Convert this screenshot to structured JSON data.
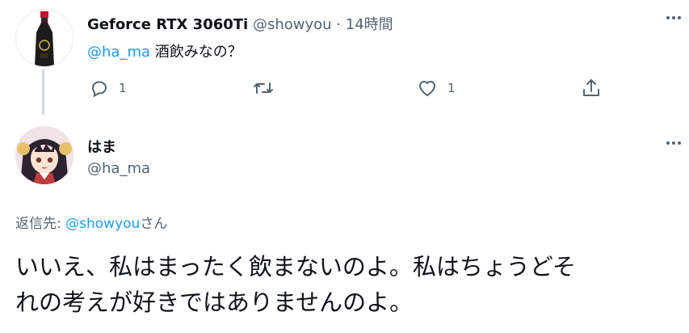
{
  "parent_tweet": {
    "author_name": "Geforce RTX 3060Ti",
    "author_handle": "@showyou",
    "separator": "·",
    "time": "14時間",
    "mention": "@ha_ma",
    "text": " 酒飲みなの？",
    "actions": {
      "reply": {
        "icon": "reply-icon",
        "count": "1"
      },
      "retweet": {
        "icon": "retweet-icon",
        "count": ""
      },
      "like": {
        "icon": "heart-icon",
        "count": "1"
      },
      "share": {
        "icon": "share-icon"
      }
    },
    "avatar": "soy-sauce-bottle"
  },
  "main_tweet": {
    "author_name": "はま",
    "author_handle": "@ha_ma",
    "reply_to_prefix": "返信先: ",
    "reply_to_handle": "@showyou",
    "reply_to_suffix": "さん",
    "text_line1": "いいえ、私はまったく飲まないのよ。私はちょうどそ",
    "text_line2": "れの考えが好きではありませんのよ。",
    "avatar": "anime-girl"
  },
  "more_icon": "more-dots-icon",
  "colors": {
    "accent": "#1d9bf0",
    "muted": "#536471",
    "text": "#0f1419",
    "thread_line": "#cfd9de"
  }
}
